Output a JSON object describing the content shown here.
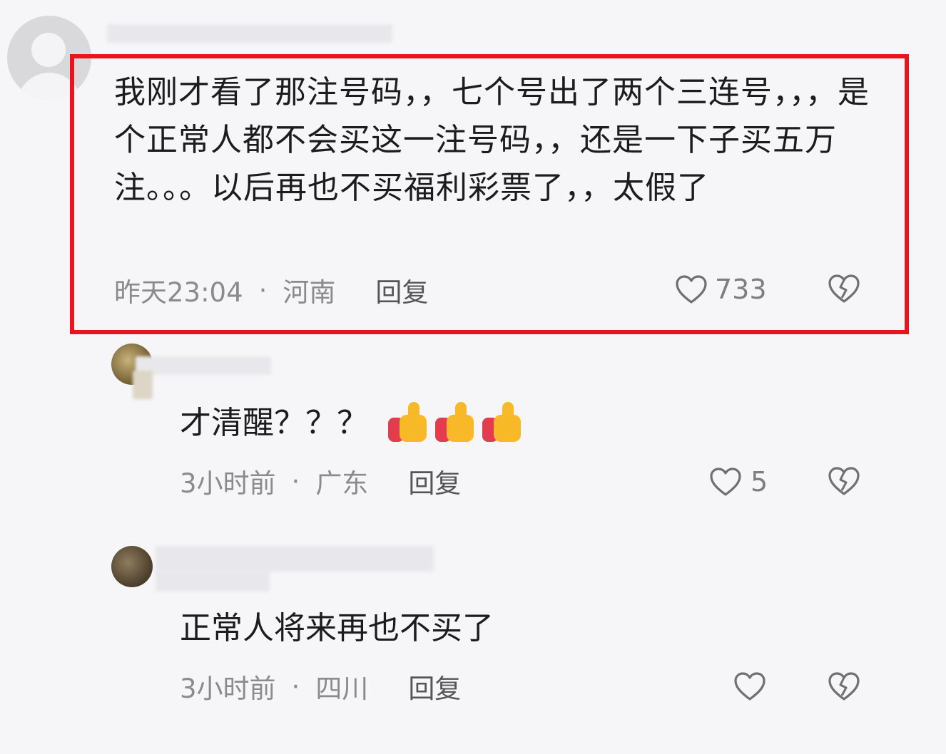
{
  "comments": [
    {
      "text": "我刚才看了那注号码，，七个号出了两个三连号，，，是个正常人都不会买这一注号码，，还是一下子买五万注。。。以后再也不买福利彩票了，，太假了",
      "time": "昨天23:04",
      "region": "河南",
      "reply_label": "回复",
      "likes": "733"
    },
    {
      "text": "才清醒？？？",
      "emojis": [
        "thumbs-up",
        "thumbs-up",
        "thumbs-up"
      ],
      "time": "3小时前",
      "region": "广东",
      "reply_label": "回复",
      "likes": "5"
    },
    {
      "text": "正常人将来再也不买了",
      "time": "3小时前",
      "region": "四川",
      "reply_label": "回复",
      "likes": ""
    }
  ],
  "meta": {
    "separator": "·"
  },
  "colors": {
    "highlight_border": "#e8141e",
    "meta_text": "#8a8a8f"
  },
  "icons": {
    "like": "heart-outline-icon",
    "dislike": "broken-heart-icon"
  }
}
